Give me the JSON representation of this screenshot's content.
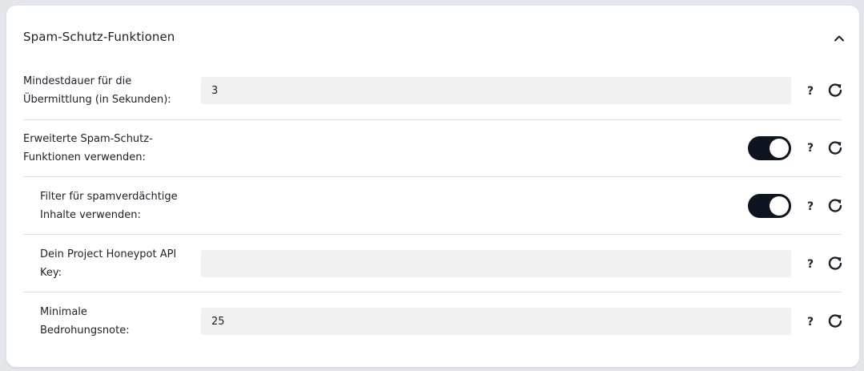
{
  "section": {
    "title": "Spam-Schutz-Funktionen",
    "collapse_icon": "chevron-up-icon"
  },
  "rows": [
    {
      "label": "Mindestdauer für die Übermittlung (in Sekunden):",
      "type": "text",
      "value": "3",
      "placeholder": ""
    },
    {
      "label": "Erweiterte Spam-Schutz-Funktionen verwenden:",
      "type": "toggle",
      "checked": true
    },
    {
      "label": "Filter für spamverdächtige Inhalte verwenden:",
      "type": "toggle",
      "checked": true
    },
    {
      "label": "Dein Project Honeypot API Key:",
      "type": "text",
      "value": "",
      "placeholder": ""
    },
    {
      "label": "Minimale Bedrohungsnote:",
      "type": "text",
      "value": "25",
      "placeholder": ""
    }
  ],
  "actions": {
    "help_symbol": "?",
    "help_icon": "question-mark-icon",
    "reset_icon": "reset-icon"
  },
  "colors": {
    "toggle_on": "#0e1520",
    "input_background": "#f1f1f1",
    "divider": "#dcdfe3"
  }
}
